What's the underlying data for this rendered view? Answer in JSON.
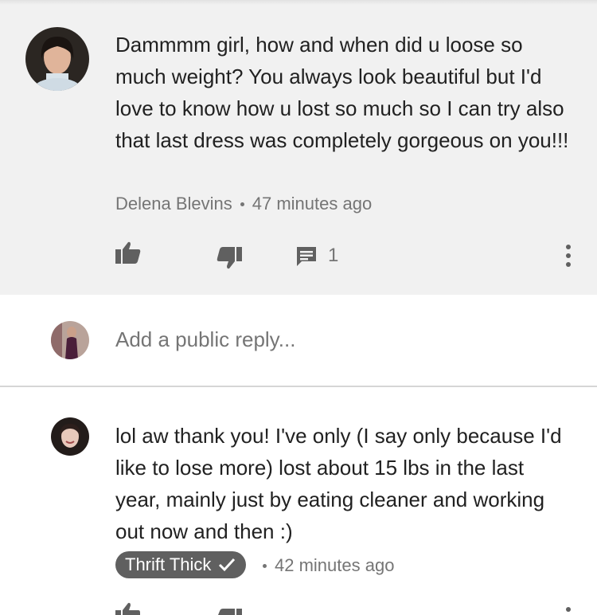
{
  "comment": {
    "text": "Dammmm girl, how and when did u loose so much weight? You always look beautiful but I'd love to know how u lost so much so I can try also that last dress was completely gorgeous on you!!!",
    "author": "Delena Blevins",
    "time": "47 minutes ago",
    "reply_count": "1",
    "icons": [
      "thumbs-up-icon",
      "thumbs-down-icon",
      "comment-icon",
      "more-vert-icon"
    ]
  },
  "reply_box": {
    "placeholder": "Add a public reply..."
  },
  "reply": {
    "text": "lol aw thank you! I've only (I say only because I'd like to lose more) lost about 15 lbs in the last year, mainly just by eating cleaner and working out now and then :)",
    "author": "Thrift Thick",
    "time": "42 minutes ago",
    "verified_icon": "check-icon"
  },
  "colors": {
    "comment_bg": "#f1f1f1",
    "text": "#212121",
    "secondary": "#757575",
    "badge_bg": "#606060"
  }
}
